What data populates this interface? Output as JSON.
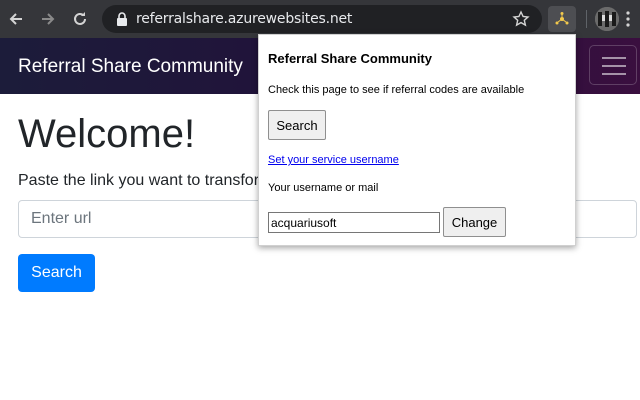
{
  "browser": {
    "url": "referralshare.azurewebsites.net",
    "icons": [
      "back-arrow-icon",
      "forward-arrow-icon",
      "reload-icon",
      "lock-icon",
      "star-icon",
      "extension-icon",
      "profile-avatar",
      "menu-icon"
    ]
  },
  "site": {
    "brand": "Referral Share Community",
    "heading": "Welcome!",
    "lead": "Paste the link you want to transfor",
    "url_placeholder": "Enter url",
    "search_label": "Search"
  },
  "popup": {
    "title": "Referral Share Community",
    "description": "Check this page to see if referral codes are available",
    "search_label": "Search",
    "set_username_link": "Set your service username",
    "username_label": "Your username or mail",
    "username_value": "acquariusoft",
    "change_label": "Change"
  },
  "colors": {
    "toolbar": "#35363a",
    "primary_button": "#007bff",
    "link": "#0000ee"
  }
}
